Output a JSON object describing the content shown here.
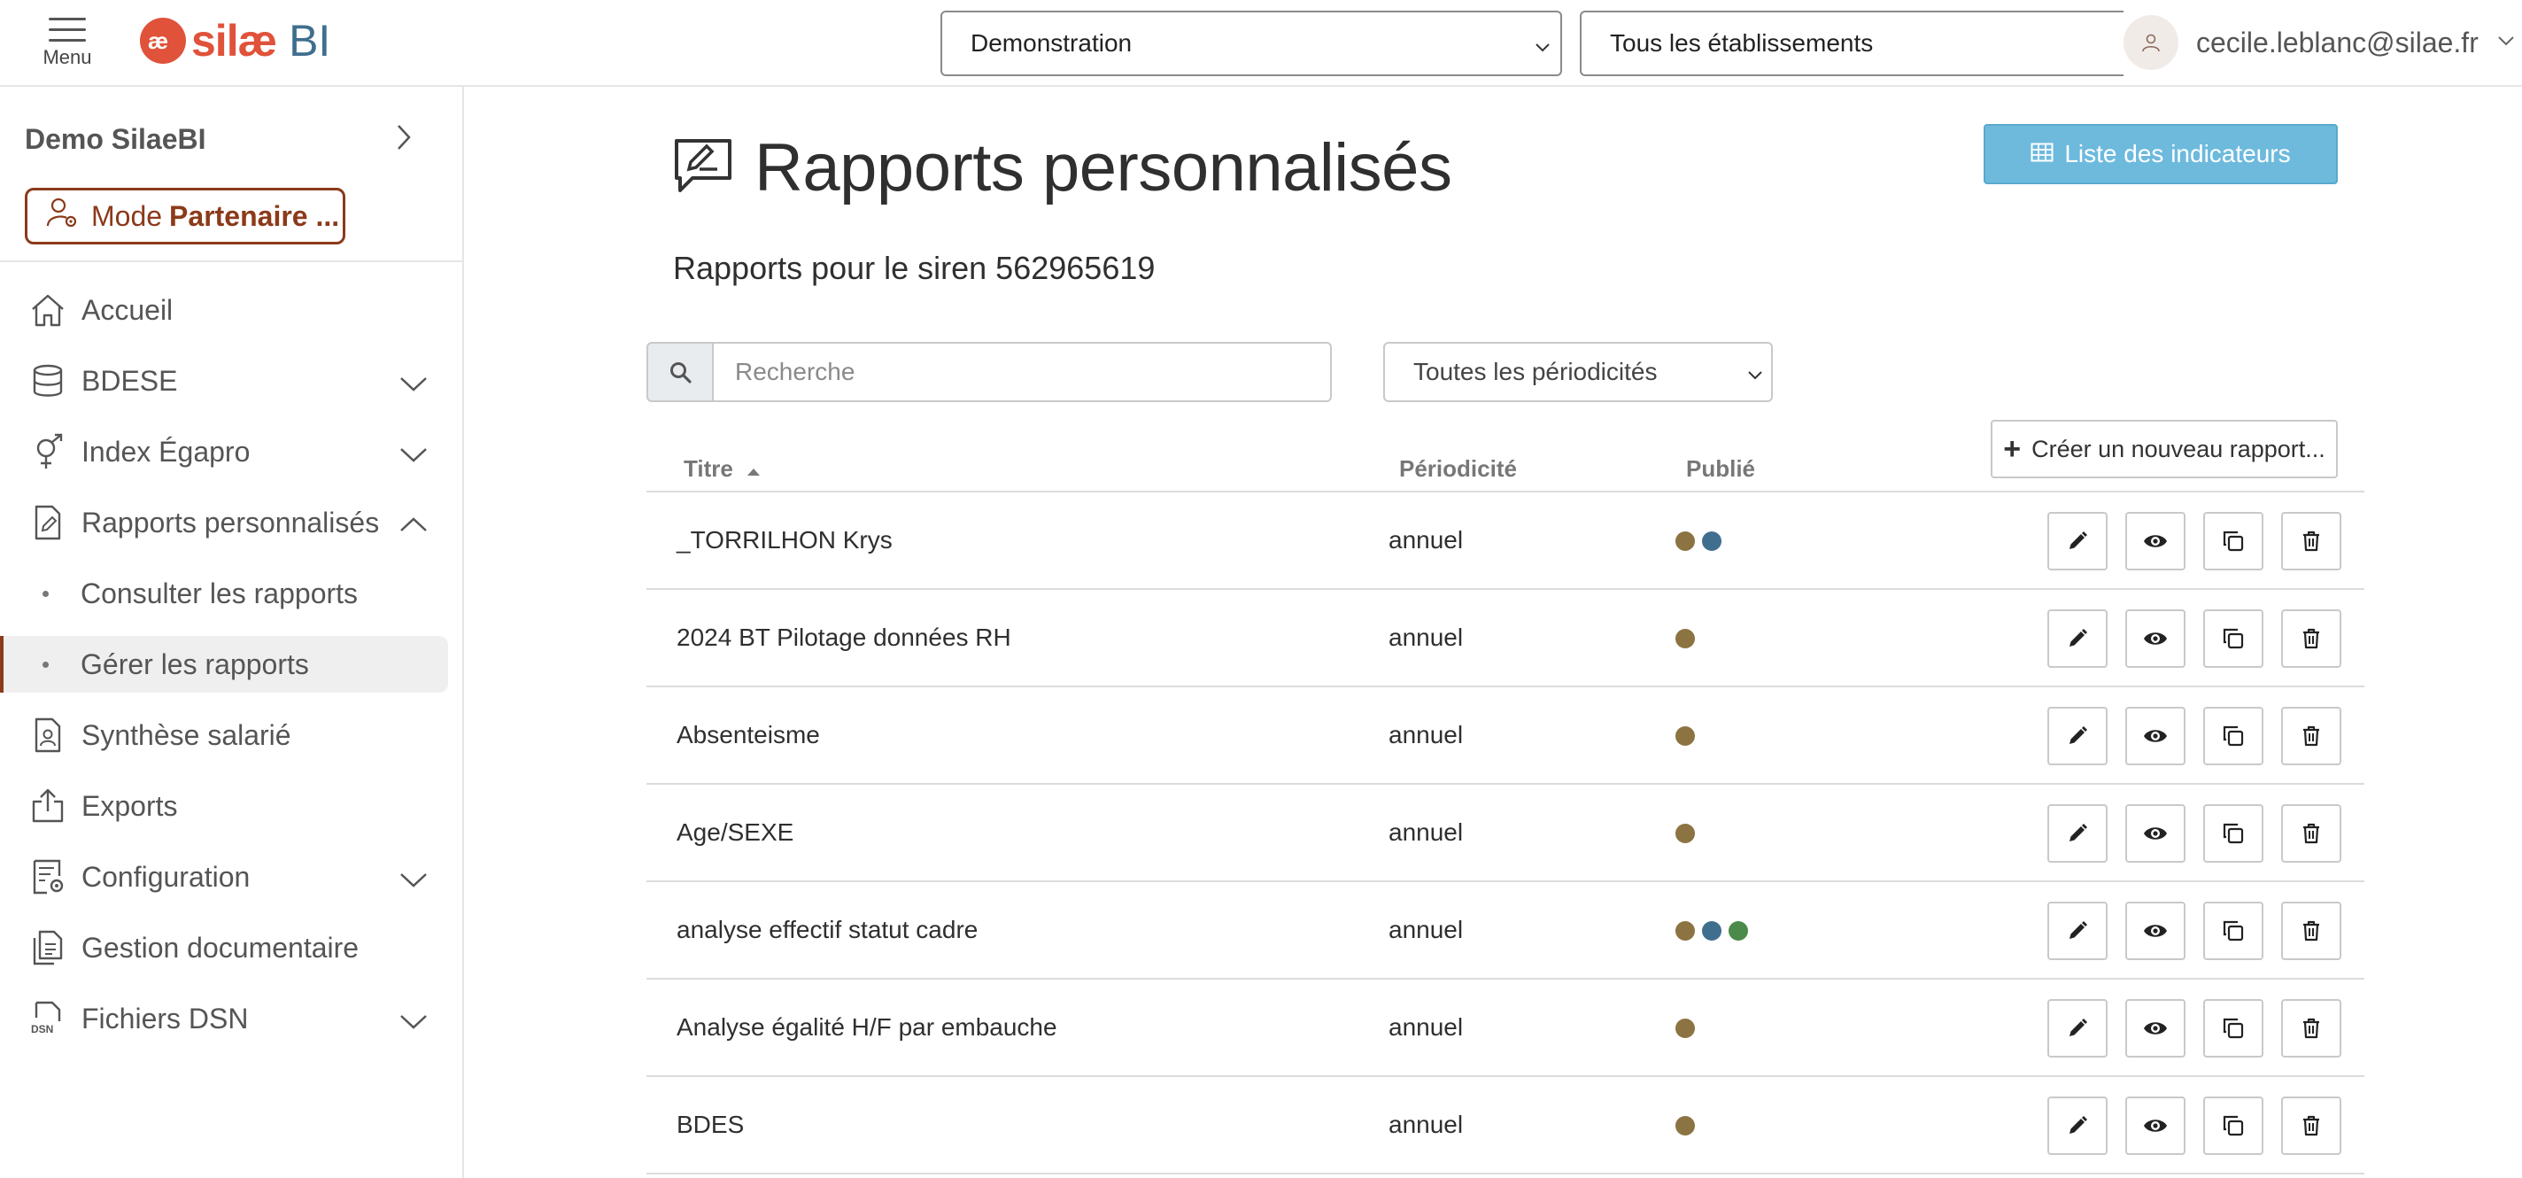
{
  "header": {
    "menu_label": "Menu",
    "logo_text": "silæ",
    "logo_suffix": "BI",
    "company_select": "Demonstration",
    "establishment_select": "Tous les établissements",
    "user_email": "cecile.leblanc@silae.fr"
  },
  "sidebar": {
    "org_name": "Demo SilaeBI",
    "mode_prefix": "Mode",
    "mode_bold": "Partenaire ...",
    "items": [
      {
        "label": "Accueil",
        "icon": "home-icon"
      },
      {
        "label": "BDESE",
        "icon": "database-icon"
      },
      {
        "label": "Index Égapro",
        "icon": "gender-icon"
      },
      {
        "label": "Rapports personnalisés",
        "icon": "report-edit-icon"
      },
      {
        "label": "Consulter les rapports"
      },
      {
        "label": "Gérer les rapports"
      },
      {
        "label": "Synthèse salarié",
        "icon": "employee-file-icon"
      },
      {
        "label": "Exports",
        "icon": "export-icon"
      },
      {
        "label": "Configuration",
        "icon": "config-icon"
      },
      {
        "label": "Gestion documentaire",
        "icon": "documents-icon"
      },
      {
        "label": "Fichiers DSN",
        "icon": "dsn-file-icon",
        "icon_text": "DSN"
      }
    ]
  },
  "main": {
    "title": "Rapports personnalisés",
    "indicators_button": "Liste des indicateurs",
    "subtitle": "Rapports pour le siren 562965619",
    "search_placeholder": "Recherche",
    "periodicity_filter": "Toutes les périodicités",
    "create_button": "Créer un nouveau rapport...",
    "columns": {
      "title": "Titre",
      "period": "Périodicité",
      "published": "Publié"
    },
    "colors": {
      "brown": "#8c7342",
      "blue": "#3f6f8f",
      "green": "#4b8a4b"
    },
    "rows": [
      {
        "title": "_TORRILHON Krys",
        "period": "annuel",
        "published": [
          "brown",
          "blue"
        ]
      },
      {
        "title": "2024 BT Pilotage données RH",
        "period": "annuel",
        "published": [
          "brown"
        ]
      },
      {
        "title": "Absenteisme",
        "period": "annuel",
        "published": [
          "brown"
        ]
      },
      {
        "title": "Age/SEXE",
        "period": "annuel",
        "published": [
          "brown"
        ]
      },
      {
        "title": "analyse effectif statut cadre",
        "period": "annuel",
        "published": [
          "brown",
          "blue",
          "green"
        ]
      },
      {
        "title": "Analyse égalité H/F par embauche",
        "period": "annuel",
        "published": [
          "brown"
        ]
      },
      {
        "title": "BDES",
        "period": "annuel",
        "published": [
          "brown"
        ]
      }
    ]
  }
}
